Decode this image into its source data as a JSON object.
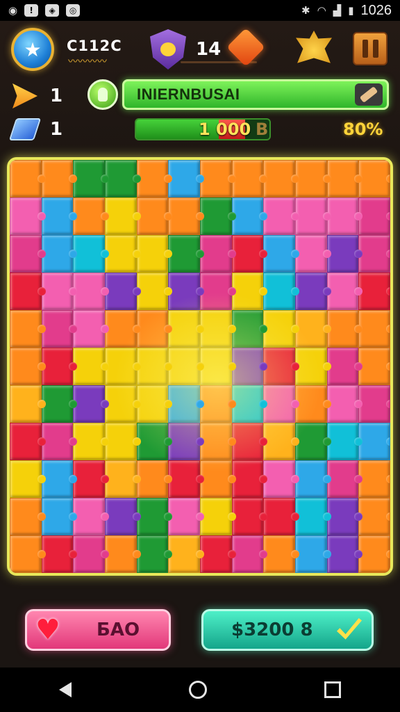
{
  "status_bar": {
    "time": "1026",
    "icons": [
      "eye-icon",
      "alert-icon",
      "shield-icon",
      "gamepad-icon",
      "bluetooth-icon",
      "wifi-icon",
      "signal-icon",
      "battery-icon"
    ]
  },
  "hud": {
    "player_id": "C112C",
    "level_value": "14",
    "arrows_count": "1",
    "crystals_count": "1",
    "banner_text": "INIERNBUSAI",
    "score_text": "1 000",
    "score_unit": "B",
    "percent_text": "80%",
    "score_progress": 0.62,
    "score_red_fraction": 0.2
  },
  "board": {
    "columns": 12,
    "rows": 11,
    "palette": [
      "#ff8a1c",
      "#2ea8e8",
      "#e23c8c",
      "#f5d10a",
      "#1f9a34",
      "#7a3bbd",
      "#e8213a",
      "#f35fb0",
      "#11c0d8",
      "#ffb21c"
    ],
    "pattern": [
      [
        0,
        0,
        4,
        4,
        0,
        1,
        0,
        0,
        0,
        0,
        0,
        0
      ],
      [
        7,
        1,
        0,
        3,
        0,
        0,
        4,
        1,
        7,
        7,
        7,
        2
      ],
      [
        2,
        1,
        8,
        3,
        3,
        4,
        2,
        6,
        1,
        7,
        5,
        2
      ],
      [
        6,
        7,
        7,
        5,
        3,
        5,
        2,
        3,
        8,
        5,
        7,
        6
      ],
      [
        0,
        2,
        7,
        0,
        0,
        3,
        3,
        4,
        3,
        9,
        0,
        0
      ],
      [
        0,
        6,
        3,
        3,
        3,
        3,
        3,
        5,
        6,
        3,
        2,
        0
      ],
      [
        9,
        4,
        5,
        3,
        3,
        1,
        0,
        8,
        7,
        0,
        7,
        2
      ],
      [
        6,
        2,
        3,
        3,
        4,
        5,
        0,
        6,
        9,
        4,
        8,
        1
      ],
      [
        3,
        1,
        6,
        9,
        0,
        6,
        0,
        6,
        7,
        1,
        2,
        0
      ],
      [
        0,
        1,
        7,
        5,
        4,
        7,
        3,
        6,
        6,
        8,
        5,
        0
      ],
      [
        0,
        6,
        2,
        0,
        4,
        9,
        6,
        2,
        0,
        1,
        5,
        0
      ]
    ]
  },
  "bottom": {
    "life_label": "БАО",
    "price_label": "$3200 8"
  },
  "navbar": {
    "buttons": [
      "back",
      "home",
      "recents"
    ]
  }
}
